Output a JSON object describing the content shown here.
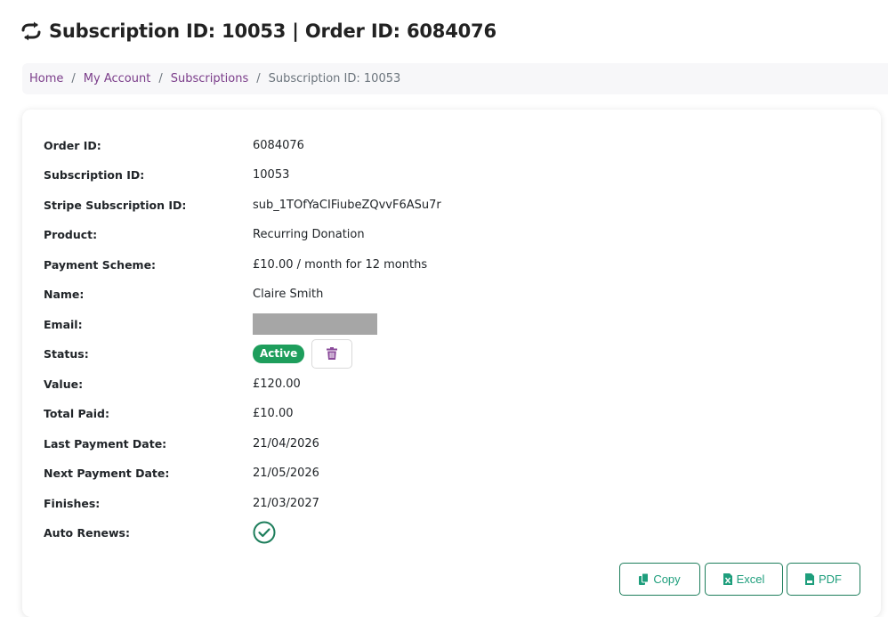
{
  "header": {
    "title": "Subscription ID: 10053 | Order ID: 6084076",
    "icon": "sync-icon"
  },
  "breadcrumb": {
    "home": "Home",
    "account": "My Account",
    "subscriptions": "Subscriptions",
    "current": "Subscription ID: 10053",
    "separator": "/"
  },
  "details": {
    "order_id": {
      "label": "Order ID:",
      "value": "6084076"
    },
    "subscription_id": {
      "label": "Subscription ID:",
      "value": "10053"
    },
    "stripe_id": {
      "label": "Stripe Subscription ID:",
      "value": "sub_1TOfYaCIFiubeZQvvF6ASu7r"
    },
    "product": {
      "label": "Product:",
      "value": "Recurring Donation"
    },
    "payment_scheme": {
      "label": "Payment Scheme:",
      "value": "£10.00 / month for 12 months"
    },
    "name": {
      "label": "Name:",
      "value": "Claire Smith"
    },
    "email": {
      "label": "Email:",
      "value": ""
    },
    "status": {
      "label": "Status:",
      "value": "Active"
    },
    "value": {
      "label": "Value:",
      "value": "£120.00"
    },
    "total_paid": {
      "label": "Total Paid:",
      "value": "£10.00"
    },
    "last_payment": {
      "label": "Last Payment Date:",
      "value": "21/04/2026"
    },
    "next_payment": {
      "label": "Next Payment Date:",
      "value": "21/05/2026"
    },
    "finishes": {
      "label": "Finishes:",
      "value": "21/03/2027"
    },
    "auto_renews": {
      "label": "Auto Renews:",
      "value": true
    }
  },
  "exports": {
    "copy": "Copy",
    "excel": "Excel",
    "pdf": "PDF"
  },
  "colors": {
    "accent_link": "#7b3d8a",
    "status_active": "#1e9e5c",
    "export_green": "#1e9e7c",
    "check_green": "#1e7e5c",
    "delete_purple": "#8a4a9a"
  }
}
